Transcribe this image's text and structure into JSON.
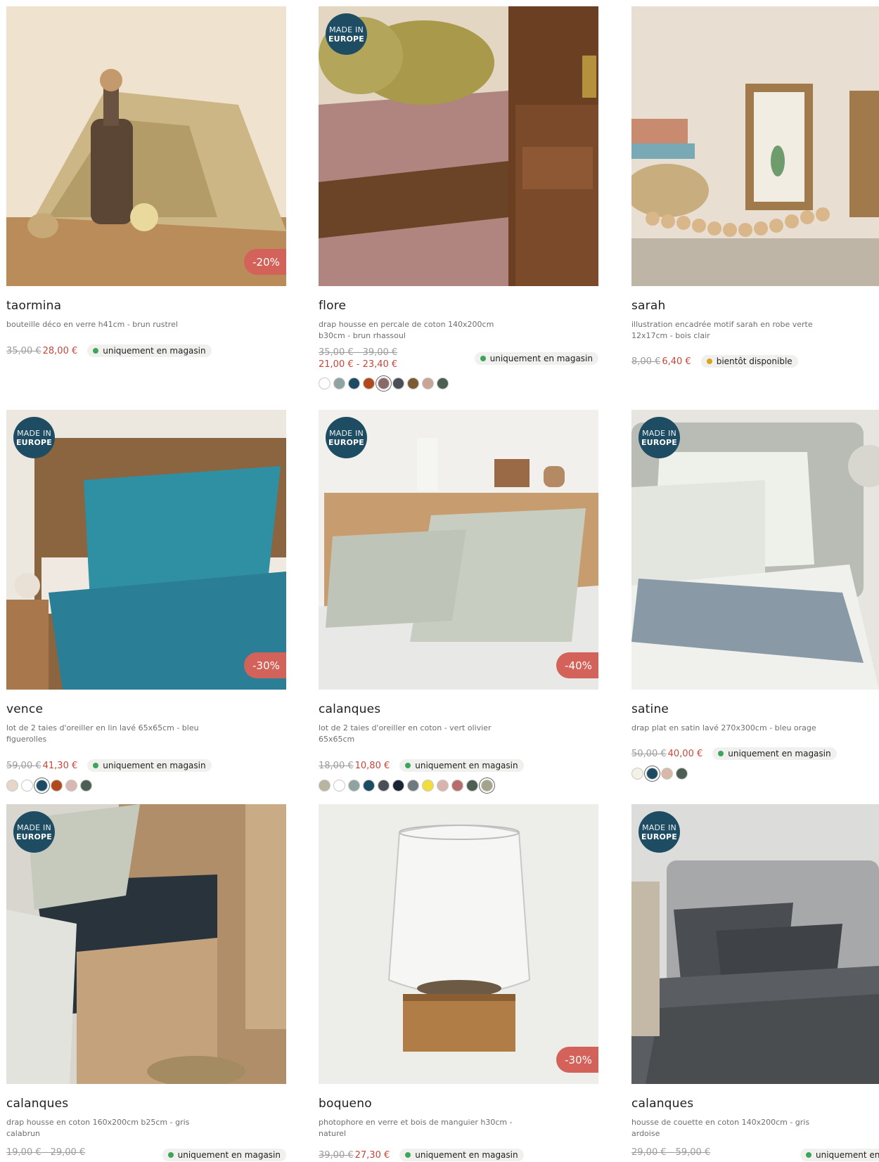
{
  "badges": {
    "made_line1": "MADE IN",
    "made_line2": "EUROPE"
  },
  "products": [
    {
      "title": "taormina",
      "desc": "bouteille déco en verre h41cm - brun rustrel",
      "old_price": "35,00 €",
      "new_price": "28,00 €",
      "discount": "-20%",
      "made_in_europe": false,
      "availability": "uniquement en magasin",
      "availability_status": "in-store",
      "swatches": []
    },
    {
      "title": "flore",
      "desc": "drap housse en percale de coton 140x200cm b30cm - brun rhassoul",
      "old_price": "35,00 € - 39,00 €",
      "new_price": "21,00 € - 23,40 €",
      "discount": "",
      "made_in_europe": true,
      "availability": "uniquement en magasin",
      "availability_status": "in-store",
      "swatches": [
        "#ffffff",
        "#8fa3a3",
        "#1c4c63",
        "#b04a1c",
        "#8a6a66",
        "#4a4f55",
        "#7c5a32",
        "#c9a598",
        "#4d5e52"
      ],
      "selected_swatch": 4
    },
    {
      "title": "sarah",
      "desc": "illustration encadrée motif sarah en robe verte 12x17cm - bois clair",
      "old_price": "8,00 €",
      "new_price": "6,40 €",
      "discount": "",
      "made_in_europe": false,
      "availability": "bientôt disponible",
      "availability_status": "soon",
      "swatches": []
    },
    {
      "title": "vence",
      "desc": "lot de 2 taies d'oreiller en lin lavé 65x65cm - bleu figuerolles",
      "old_price": "59,00 €",
      "new_price": "41,30 €",
      "discount": "-30%",
      "made_in_europe": true,
      "availability": "uniquement en magasin",
      "availability_status": "in-store",
      "swatches": [
        "#e6d6c8",
        "#ffffff",
        "#1c4c63",
        "#b04a1c",
        "#d8b8b0",
        "#4d5e52"
      ],
      "selected_swatch": 2
    },
    {
      "title": "calanques",
      "desc": "lot de 2 taies d'oreiller en coton - vert olivier 65x65cm",
      "old_price": "18,00 €",
      "new_price": "10,80 €",
      "discount": "-40%",
      "made_in_europe": true,
      "availability": "uniquement en magasin",
      "availability_status": "in-store",
      "swatches": [
        "#b7b59e",
        "#ffffff",
        "#8fa3a3",
        "#1c4c63",
        "#4a4f55",
        "#1a2433",
        "#6f7a80",
        "#f2dd3c",
        "#d9b4ae",
        "#b86c6c",
        "#4d5e52",
        "#a3a48a"
      ],
      "selected_swatch": 11
    },
    {
      "title": "satine",
      "desc": "drap plat en satin lavé 270x300cm - bleu orage",
      "old_price": "50,00 €",
      "new_price": "40,00 €",
      "discount": "",
      "made_in_europe": true,
      "availability": "uniquement en magasin",
      "availability_status": "in-store",
      "swatches": [
        "#f4f2e6",
        "#1c4c63",
        "#d8b8a8",
        "#4d5e52"
      ],
      "selected_swatch": 1
    },
    {
      "title": "calanques",
      "desc": "drap housse en coton 160x200cm b25cm - gris calabrun",
      "old_price": "19,00 € - 29,00 €",
      "new_price": "",
      "discount": "",
      "made_in_europe": true,
      "availability": "uniquement en magasin",
      "availability_status": "in-store",
      "swatches": []
    },
    {
      "title": "boqueno",
      "desc": "photophore en verre et bois de manguier h30cm - naturel",
      "old_price": "39,00 €",
      "new_price": "27,30 €",
      "discount": "-30%",
      "made_in_europe": false,
      "availability": "uniquement en magasin",
      "availability_status": "in-store",
      "swatches": []
    },
    {
      "title": "calanques",
      "desc": "housse de couette en coton 140x200cm - gris ardoise",
      "old_price": "29,00 € - 59,00 €",
      "new_price": "",
      "discount": "",
      "made_in_europe": true,
      "availability": "uniquement en m",
      "availability_status": "in-store",
      "swatches": []
    }
  ]
}
